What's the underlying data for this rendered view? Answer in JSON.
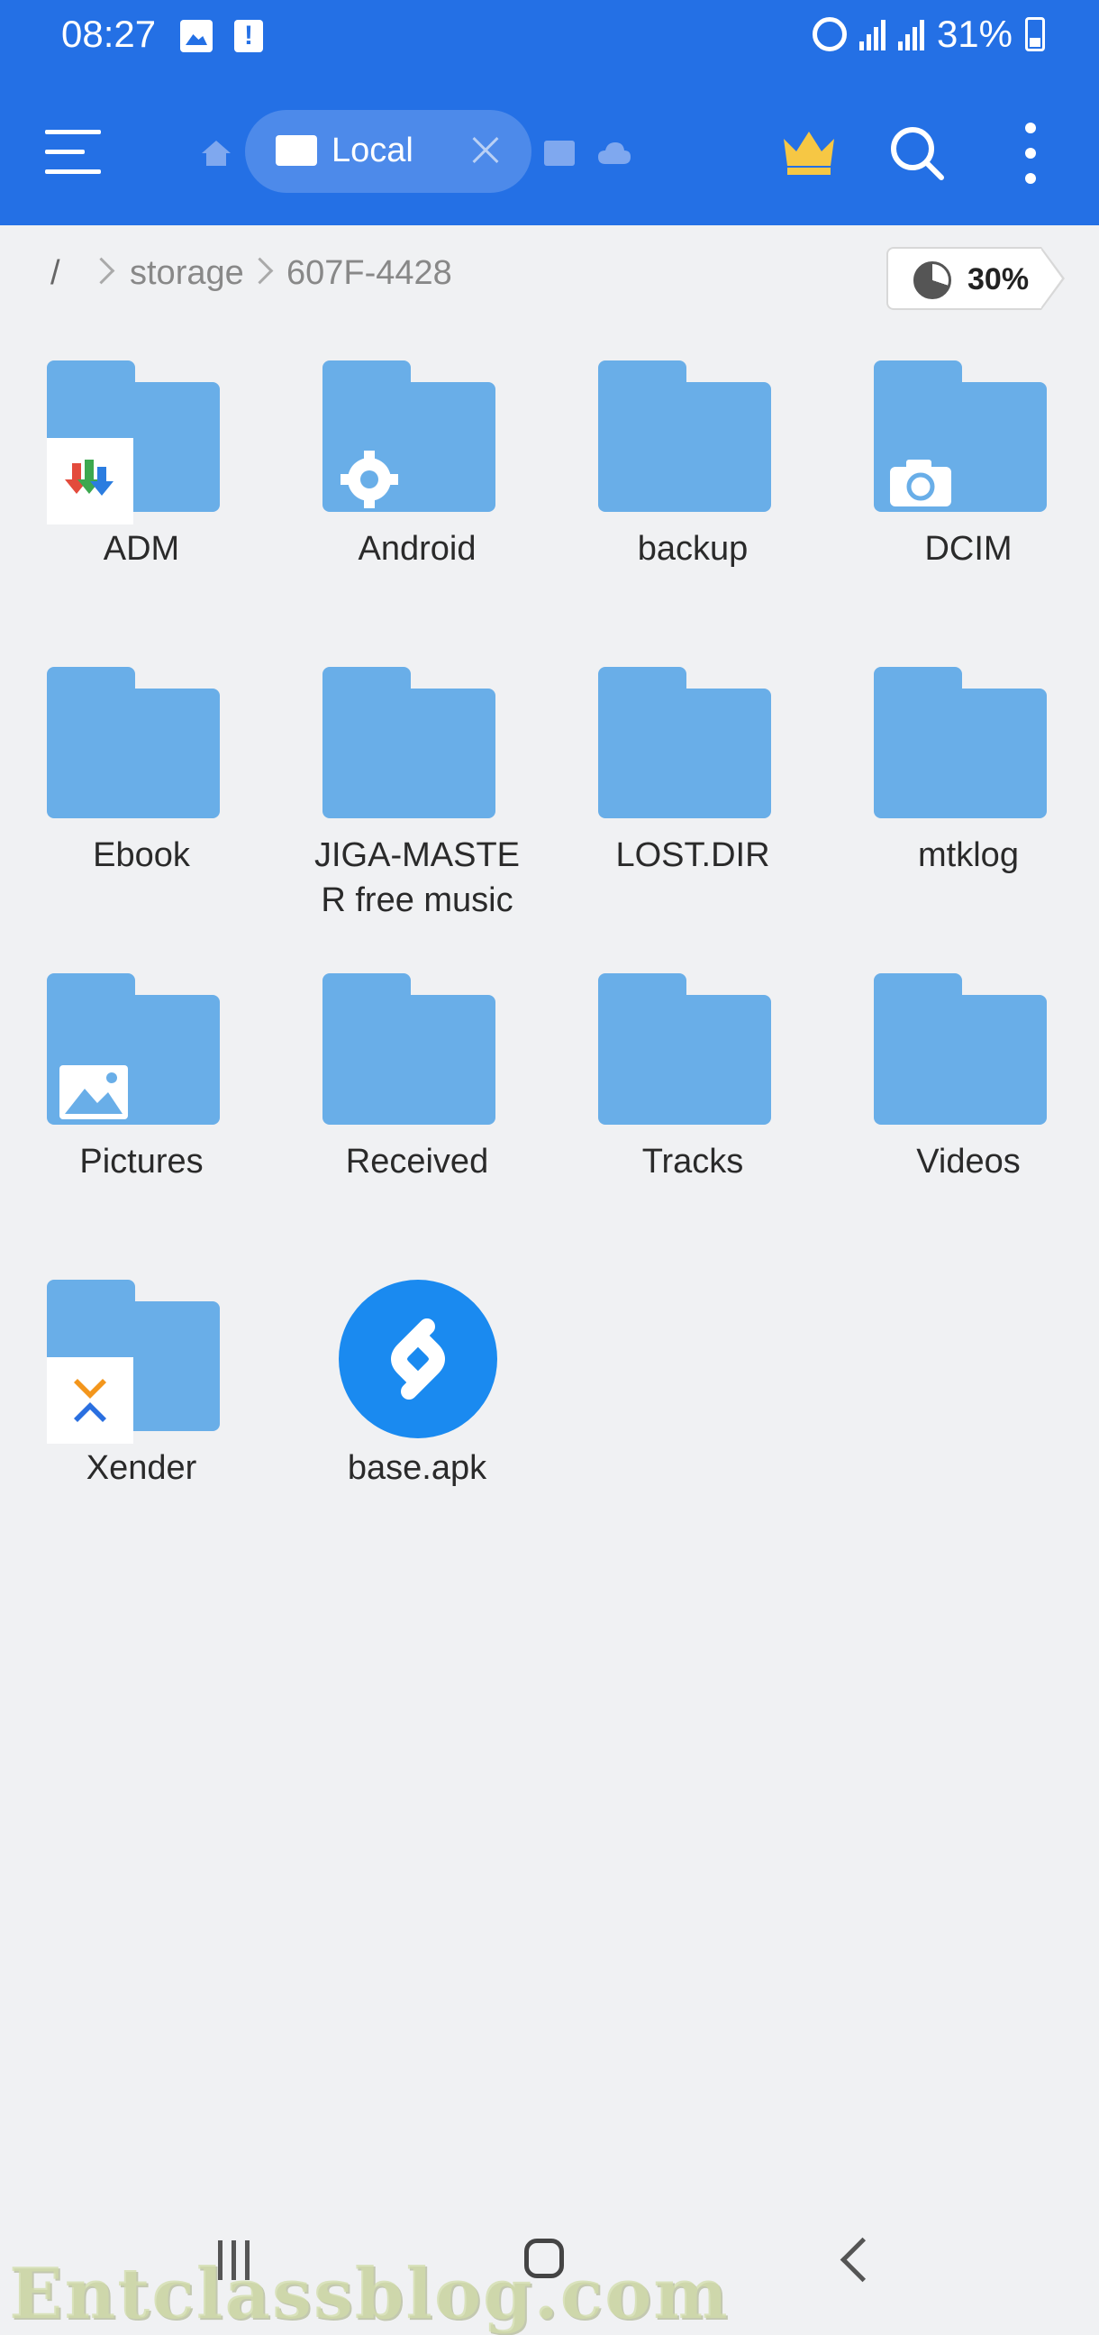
{
  "status_bar": {
    "time": "08:27",
    "battery_percent": "31%",
    "left_icons": [
      "gallery-icon",
      "alert-icon"
    ],
    "right_icons": [
      "alarm-icon",
      "signal-icon",
      "signal-icon",
      "battery-charging-icon"
    ]
  },
  "toolbar": {
    "active_tab_label": "Local",
    "icons": [
      "menu-icon",
      "home-icon",
      "sd-card-icon",
      "cloud-icon",
      "crown-icon",
      "search-icon",
      "more-icon"
    ],
    "accent_color": "#2470e5"
  },
  "breadcrumb": {
    "root": "/",
    "items": [
      "storage",
      "607F-4428"
    ]
  },
  "storage_usage": {
    "percent_label": "30%",
    "fraction": 0.3
  },
  "items": [
    {
      "label": "ADM",
      "type": "folder",
      "badge": "adm-icon"
    },
    {
      "label": "Android",
      "type": "folder",
      "badge": "gear-icon"
    },
    {
      "label": "backup",
      "type": "folder",
      "badge": ""
    },
    {
      "label": "DCIM",
      "type": "folder",
      "badge": "camera-icon"
    },
    {
      "label": "Ebook",
      "type": "folder",
      "badge": ""
    },
    {
      "label": "JIGA-MASTE\nR free music",
      "type": "folder",
      "badge": ""
    },
    {
      "label": "LOST.DIR",
      "type": "folder",
      "badge": ""
    },
    {
      "label": "mtklog",
      "type": "folder",
      "badge": ""
    },
    {
      "label": "Pictures",
      "type": "folder",
      "badge": "picture-icon"
    },
    {
      "label": "Received",
      "type": "folder",
      "badge": ""
    },
    {
      "label": "Tracks",
      "type": "folder",
      "badge": ""
    },
    {
      "label": "Videos",
      "type": "folder",
      "badge": ""
    },
    {
      "label": "Xender",
      "type": "folder",
      "badge": "xender-icon"
    },
    {
      "label": "base.apk",
      "type": "apk",
      "badge": "shazam-icon"
    }
  ],
  "watermark": "Entclassblog.com"
}
